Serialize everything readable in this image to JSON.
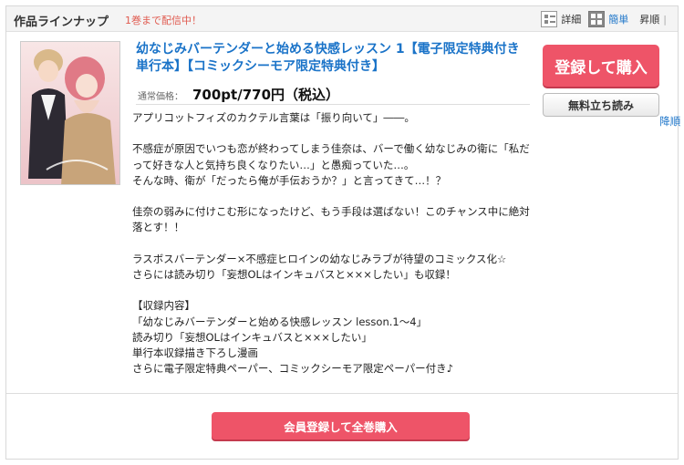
{
  "header": {
    "title": "作品ラインナップ",
    "volume_notice": "1巻まで配信中！",
    "view_detail_label": "詳細",
    "view_simple_label": "簡単",
    "sort_asc_label": "昇順",
    "sort_separator": "|",
    "sort_desc_label": "降順"
  },
  "book": {
    "title": "幼なじみバーテンダーと始める快感レッスン 1【電子限定特典付き単行本】【コミックシーモア限定特典付き】",
    "price_label": "通常価格：",
    "price_value": "700pt/770円（税込）",
    "description_lines": [
      "アプリコットフィズのカクテル言葉は「振り向いて」――。",
      "",
      "不感症が原因でいつも恋が終わってしまう佳奈は、バーで働く幼なじみの衛に「私だって好きな人と気持ち良くなりたい…」と愚痴っていた…。",
      "そんな時、衛が「だったら俺が手伝おうか？」と言ってきて…！？",
      "",
      "佳奈の弱みに付けこむ形になったけど、もう手段は選ばない！このチャンス中に絶対落とす！！",
      "",
      "ラスボスバーテンダー×不感症ヒロインの幼なじみラブが待望のコミックス化☆",
      "さらには読み切り「妄想OLはインキュバスと×××したい」も収録！",
      "",
      "【収録内容】",
      "「幼なじみバーテンダーと始める快感レッスン lesson.1〜4」",
      "読み切り「妄想OLはインキュバスと×××したい」",
      "単行本収録描き下ろし漫画",
      "さらに電子限定特典ペーパー、コミックシーモア限定ペーパー付き♪"
    ]
  },
  "actions": {
    "buy_label": "登録して購入",
    "trial_label": "無料立ち読み",
    "buy_all_label": "会員登録して全巻購入"
  },
  "colors": {
    "accent_pink": "#ee5468",
    "link_blue": "#1a73c8",
    "notice_red": "#e05a4f"
  },
  "icons": {
    "detail_view": "list-view-icon",
    "simple_view": "grid-view-icon"
  }
}
